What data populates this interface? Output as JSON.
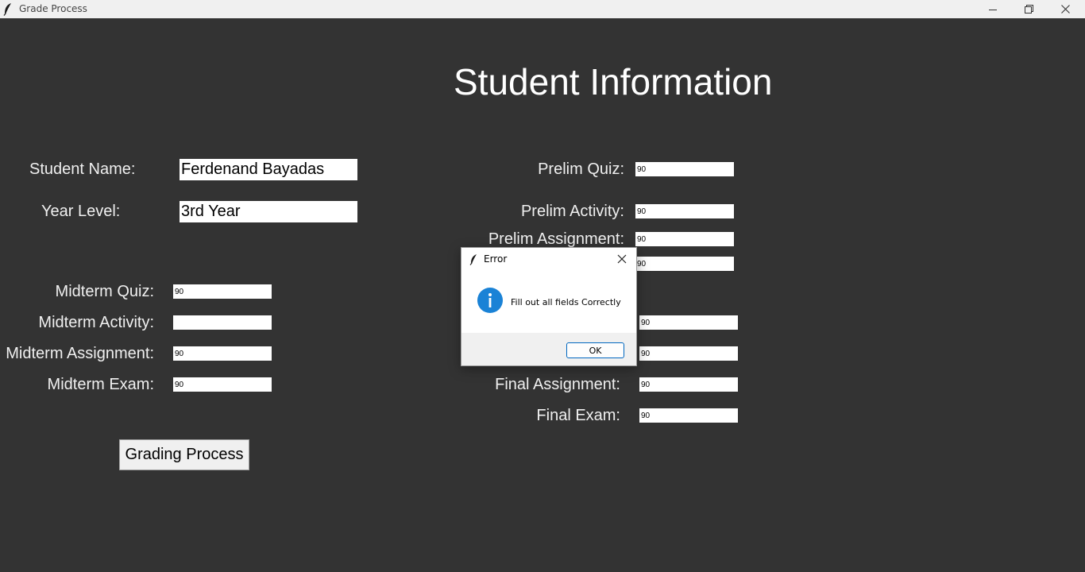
{
  "window": {
    "title": "Grade Process"
  },
  "page": {
    "title": "Student Information"
  },
  "student": {
    "name_label": "Student Name:",
    "name_value": "Ferdenand Bayadas",
    "year_label": "Year Level:",
    "year_value": "3rd Year"
  },
  "prelim": {
    "quiz_label": "Prelim Quiz:",
    "quiz_value": "90",
    "activity_label": "Prelim Activity:",
    "activity_value": "90",
    "assignment_label": "Prelim Assignment:",
    "assignment_value": "90",
    "exam_value": "90"
  },
  "midterm": {
    "quiz_label": "Midterm Quiz:",
    "quiz_value": "90",
    "activity_label": "Midterm Activity:",
    "activity_value": "",
    "assignment_label": "Midterm Assignment:",
    "assignment_value": "90",
    "exam_label": "Midterm Exam:",
    "exam_value": "90"
  },
  "final": {
    "quiz_value": "90",
    "activity_value": "90",
    "assignment_label": "Final Assignment:",
    "assignment_value": "90",
    "exam_label": "Final Exam:",
    "exam_value": "90"
  },
  "actions": {
    "grade_button_label": "Grading Process"
  },
  "dialog": {
    "title": "Error",
    "message": "Fill out all fields Correctly",
    "ok_label": "OK"
  },
  "colors": {
    "background": "#333333",
    "dialog_accent": "#0067c0",
    "info_icon": "#1a82d6"
  }
}
